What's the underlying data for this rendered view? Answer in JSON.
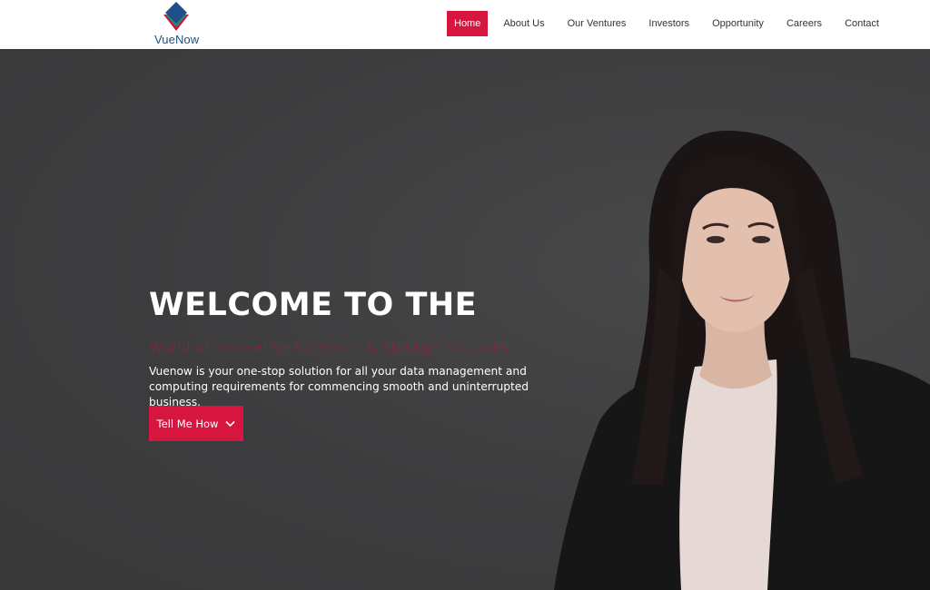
{
  "brand": {
    "name": "VueNow",
    "colors": {
      "accent": "#d7163f",
      "logo_blue": "#1f4f8a",
      "logo_green": "#2a8a6a",
      "logo_red": "#c8143e"
    }
  },
  "nav": {
    "items": [
      {
        "label": "Home",
        "active": true
      },
      {
        "label": "About Us",
        "active": false
      },
      {
        "label": "Our Ventures",
        "active": false
      },
      {
        "label": "Investors",
        "active": false
      },
      {
        "label": "Opportunity",
        "active": false
      },
      {
        "label": "Careers",
        "active": false
      },
      {
        "label": "Contact",
        "active": false
      }
    ]
  },
  "hero": {
    "title": "WELCOME TO THE",
    "subtitle": "World of innovative Compute & Storage Solutions",
    "description": "Vuenow is your one-stop solution for all your data management and computing requirements for commencing smooth and uninterrupted business.",
    "cta_label": "Tell Me How",
    "cta_icon": "chevron-down-icon",
    "background_color": "#3d3d3f"
  }
}
